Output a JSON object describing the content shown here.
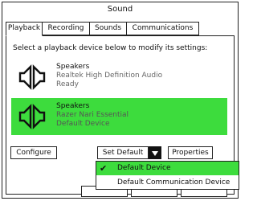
{
  "window": {
    "title": "Sound"
  },
  "tabs": [
    {
      "label": "Playback",
      "active": true
    },
    {
      "label": "Recording",
      "active": false
    },
    {
      "label": "Sounds",
      "active": false
    },
    {
      "label": "Communications",
      "active": false
    }
  ],
  "instruction": "Select a playback device below to modify its settings:",
  "devices": [
    {
      "name": "Speakers",
      "description": "Realtek High Definition Audio",
      "status": "Ready",
      "selected": false,
      "icon": "speaker-icon"
    },
    {
      "name": "Speakers",
      "description": "Razer Nari Essential",
      "status": "Default Device",
      "selected": true,
      "icon": "speaker-icon"
    }
  ],
  "buttons": {
    "configure": "Configure",
    "set_default": "Set Default",
    "properties": "Properties"
  },
  "dropdown_menu": {
    "items": [
      {
        "label": "Default Device",
        "checked": true
      },
      {
        "label": "Default Communication Device",
        "checked": false
      }
    ]
  },
  "colors": {
    "selection": "#3ddc3d",
    "border": "#222222"
  }
}
